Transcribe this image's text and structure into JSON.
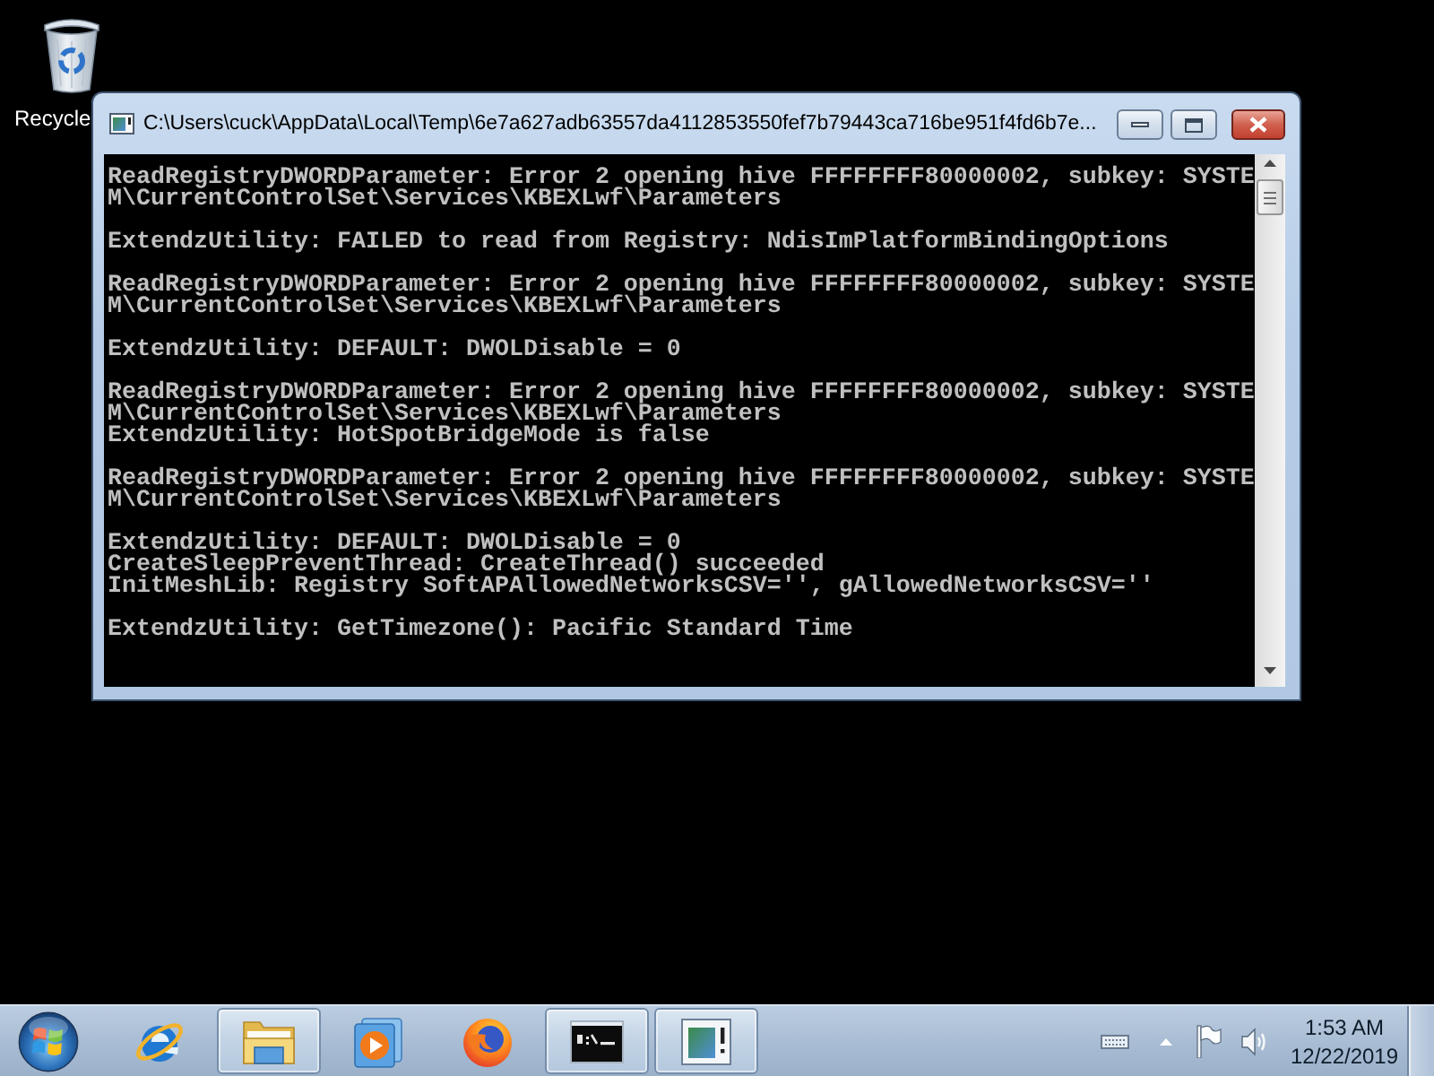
{
  "desktop": {
    "icons": [
      {
        "label": "Recycle"
      }
    ]
  },
  "window": {
    "title": "C:\\Users\\cuck\\AppData\\Local\\Temp\\6e7a627adb63557da4112853550fef7b79443ca716be951f4fd6b7e...",
    "console_blocks": [
      [
        "ReadRegistryDWORDParameter: Error 2 opening hive FFFFFFFF80000002, subkey: SYSTE",
        "M\\CurrentControlSet\\Services\\KBEXLwf\\Parameters"
      ],
      [
        "ExtendzUtility: FAILED to read from Registry: NdisImPlatformBindingOptions"
      ],
      [
        "ReadRegistryDWORDParameter: Error 2 opening hive FFFFFFFF80000002, subkey: SYSTE",
        "M\\CurrentControlSet\\Services\\KBEXLwf\\Parameters"
      ],
      [
        "ExtendzUtility: DEFAULT: DWOLDisable = 0"
      ],
      [
        "ReadRegistryDWORDParameter: Error 2 opening hive FFFFFFFF80000002, subkey: SYSTE",
        "M\\CurrentControlSet\\Services\\KBEXLwf\\Parameters",
        "ExtendzUtility: HotSpotBridgeMode is false"
      ],
      [
        "ReadRegistryDWORDParameter: Error 2 opening hive FFFFFFFF80000002, subkey: SYSTE",
        "M\\CurrentControlSet\\Services\\KBEXLwf\\Parameters"
      ],
      [
        "ExtendzUtility: DEFAULT: DWOLDisable = 0",
        "CreateSleepPreventThread: CreateThread() succeeded",
        "InitMeshLib: Registry SoftAPAllowedNetworksCSV='', gAllowedNetworksCSV=''"
      ],
      [
        "ExtendzUtility: GetTimezone(): Pacific Standard Time"
      ]
    ]
  },
  "taskbar": {
    "items": [
      {
        "kind": "browser",
        "open": false
      },
      {
        "kind": "folder",
        "open": true
      },
      {
        "kind": "player",
        "open": false
      },
      {
        "kind": "globe",
        "open": false
      },
      {
        "kind": "console",
        "open": true
      },
      {
        "kind": "window",
        "open": true
      }
    ],
    "clock": {
      "time": "1:53 AM",
      "date": "12/22/2019"
    }
  }
}
